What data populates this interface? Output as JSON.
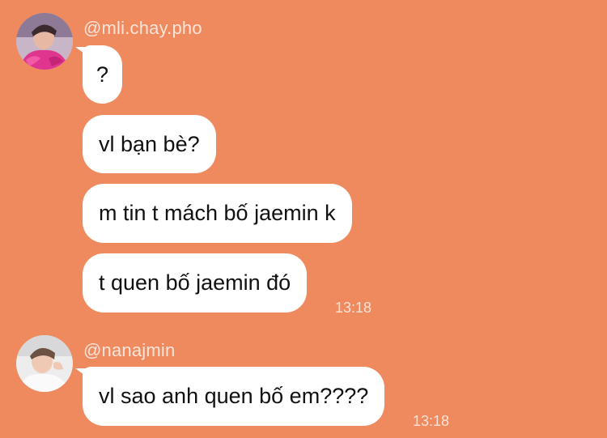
{
  "colors": {
    "background": "#EE8A5E",
    "bubble": "#FFFFFF",
    "text": "#111111"
  },
  "conversation": [
    {
      "sender": "@mli.chay.pho",
      "avatar_icon": "user-avatar-pink-outfit",
      "messages": [
        "?",
        "vl bạn bè?",
        "m tin t mách bố jaemin k",
        "t quen bố jaemin đó"
      ],
      "time": "13:18"
    },
    {
      "sender": "@nanajmin",
      "avatar_icon": "user-avatar-white-outfit",
      "messages": [
        "vl sao anh quen bố em????"
      ],
      "time": "13:18"
    }
  ]
}
